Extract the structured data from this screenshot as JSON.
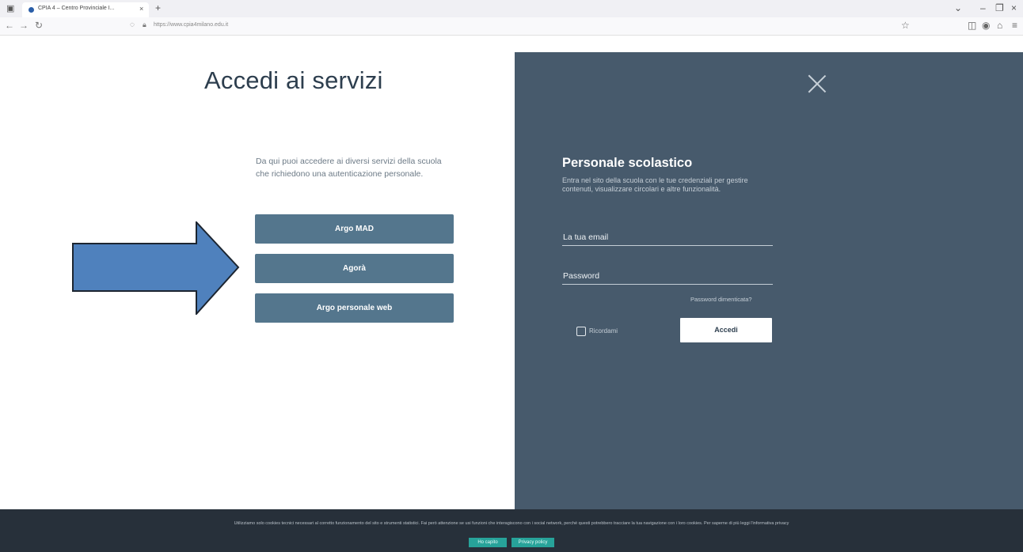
{
  "browser": {
    "tab_title": "CPIA 4 – Centro Provinciale I...",
    "url": "https://www.cpia4milano.edu.it"
  },
  "page": {
    "title": "Accedi ai servizi",
    "description": "Da qui puoi accedere ai diversi servizi della scuola che richiedono una autenticazione personale.",
    "services": [
      "Argo MAD",
      "Agorà",
      "Argo personale web"
    ]
  },
  "login_panel": {
    "title": "Personale scolastico",
    "description": "Entra nel sito della scuola con le tue credenziali per gestire contenuti, visualizzare circolari e altre funzionalità.",
    "email_label": "La tua email",
    "password_label": "Password",
    "forgot_label": "Password dimenticata?",
    "remember_label": "Ricordami",
    "submit_label": "Accedi"
  },
  "cookie_banner": {
    "text": "Utilizziamo solo cookies tecnici necessari al corretto funzionamento del sito e strumenti statistici. Fai però attenzione se usi funzioni che interagiscono con i social network, perché questi potrebbero tracciare la tua navigazione con i loro cookies. Per saperne di più leggi l'informativa privacy",
    "accept_label": "Ho capito",
    "privacy_label": "Privacy policy"
  },
  "colors": {
    "panel": "#475a6c",
    "service_button": "#54768d",
    "cookie_bg": "#27303a",
    "cookie_button": "#27a39a",
    "arrow_fill": "#4f81bd"
  }
}
